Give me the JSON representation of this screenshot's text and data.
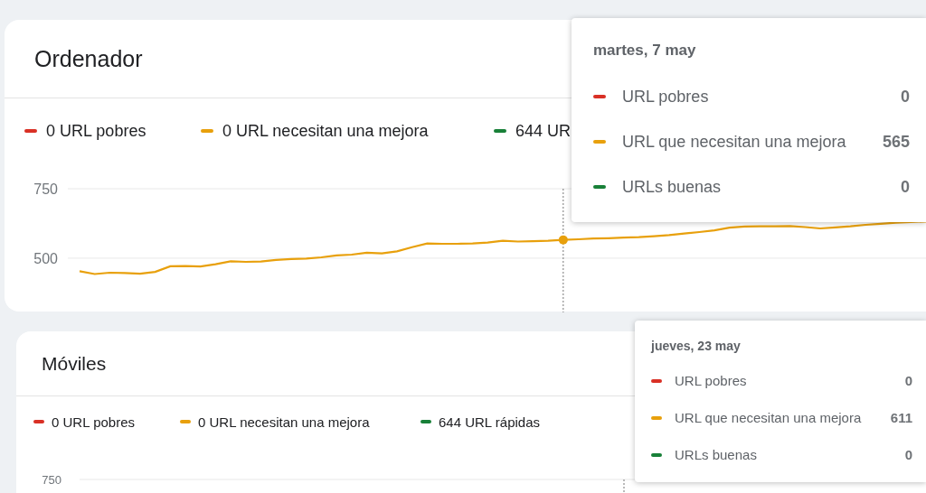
{
  "cards": [
    {
      "title": "Ordenador",
      "legend": [
        {
          "text": "0 URL pobres",
          "color": "#d93025"
        },
        {
          "text": "0 URL necesitan una mejora",
          "color": "#e8a00c"
        },
        {
          "text": "644 UR",
          "color": "#188038"
        }
      ],
      "chart_data": {
        "type": "line",
        "yticks": [
          500,
          750
        ],
        "ylim": [
          305,
          750
        ],
        "ref_lines": [
          {
            "axis": "y",
            "value": 500
          },
          {
            "axis": "y",
            "value": 750
          }
        ],
        "series": [
          {
            "color": "#e8a00c",
            "values": [
              453,
              443,
              448,
              447,
              444,
              451,
              471,
              472,
              470,
              478,
              489,
              487,
              488,
              494,
              497,
              499,
              503,
              510,
              513,
              520,
              517,
              525,
              540,
              553,
              552,
              552,
              553,
              556,
              563,
              560,
              561,
              563,
              566,
              568,
              571,
              572,
              574,
              576,
              579,
              583,
              589,
              594,
              600,
              610,
              614,
              615,
              615,
              616,
              612,
              607,
              611,
              615,
              620,
              624,
              628,
              630,
              632
            ]
          }
        ]
      },
      "tooltip": {
        "date": "martes, 7 may",
        "rows": [
          {
            "label": "URL pobres",
            "value": "0",
            "color": "#d93025"
          },
          {
            "label": "URL que necesitan una mejora",
            "value": "565",
            "color": "#e8a00c"
          },
          {
            "label": "URLs buenas",
            "value": "0",
            "color": "#188038"
          }
        ]
      }
    },
    {
      "title": "Móviles",
      "legend": [
        {
          "text": "0 URL pobres",
          "color": "#d93025"
        },
        {
          "text": "0 URL necesitan una mejora",
          "color": "#e8a00c"
        },
        {
          "text": "644 URL rápidas",
          "color": "#188038"
        }
      ],
      "y_axis_labels": [
        "750"
      ],
      "tooltip": {
        "date": "jueves, 23 may",
        "rows": [
          {
            "label": "URL pobres",
            "value": "0",
            "color": "#d93025"
          },
          {
            "label": "URL que necesitan una mejora",
            "value": "611",
            "color": "#e8a00c"
          },
          {
            "label": "URLs buenas",
            "value": "0",
            "color": "#188038"
          }
        ]
      }
    }
  ]
}
